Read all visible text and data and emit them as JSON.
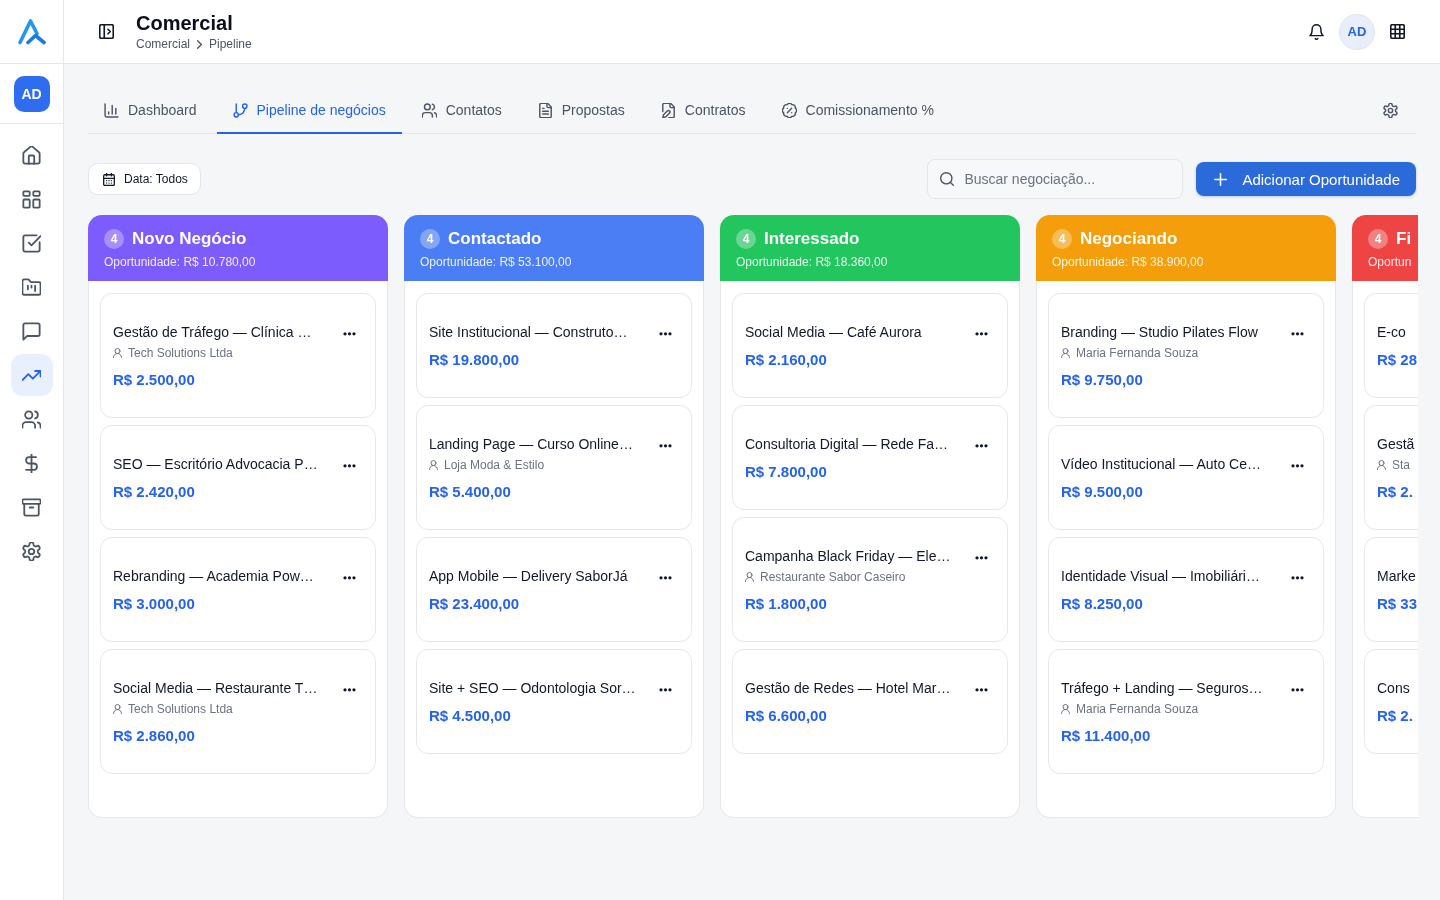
{
  "sidebar": {
    "avatar": "AD",
    "items": [
      {
        "selected": false
      },
      {
        "selected": false
      },
      {
        "selected": false
      },
      {
        "selected": false
      },
      {
        "selected": false
      },
      {
        "selected": true
      },
      {
        "selected": false
      },
      {
        "selected": false
      },
      {
        "selected": false
      },
      {
        "selected": false
      }
    ]
  },
  "header": {
    "title": "Comercial",
    "breadcrumb": [
      "Comercial",
      "Pipeline"
    ],
    "avatar": "AD"
  },
  "tabs": [
    {
      "label": "Dashboard",
      "selected": false
    },
    {
      "label": "Pipeline de negócios",
      "selected": true
    },
    {
      "label": "Contatos",
      "selected": false
    },
    {
      "label": "Propostas",
      "selected": false
    },
    {
      "label": "Contratos",
      "selected": false
    },
    {
      "label": "Comissionamento %",
      "selected": false
    }
  ],
  "toolbar": {
    "date_filter": "Data: Todos",
    "search": {
      "placeholder": "Buscar negociação..."
    },
    "add_button": "Adicionar Oportunidade"
  },
  "columns": [
    {
      "title": "Novo Negócio",
      "count": "4",
      "total": "Oportunidade: R$ 10.780,00",
      "color": "#7c5cfc",
      "cards": [
        {
          "title": "Gestão de Tráfego — Clínica …",
          "client": "Tech Solutions Ltda",
          "value": "R$ 2.500,00",
          "menu": true
        },
        {
          "title": "SEO — Escritório Advocacia P…",
          "value": "R$ 2.420,00",
          "menu": true
        },
        {
          "title": "Rebranding — Academia Pow…",
          "value": "R$ 3.000,00",
          "menu": true
        },
        {
          "title": "Social Media — Restaurante T…",
          "client": "Tech Solutions Ltda",
          "value": "R$ 2.860,00",
          "menu": true
        }
      ]
    },
    {
      "title": "Contactado",
      "count": "4",
      "total": "Oportunidade: R$ 53.100,00",
      "color": "#4b7df4",
      "cards": [
        {
          "title": "Site Institucional — Construto…",
          "value": "R$ 19.800,00",
          "menu": true
        },
        {
          "title": "Landing Page — Curso Online…",
          "client": "Loja Moda & Estilo",
          "value": "R$ 5.400,00",
          "menu": true
        },
        {
          "title": "App Mobile — Delivery SaborJá",
          "value": "R$ 23.400,00",
          "menu": true
        },
        {
          "title": "Site + SEO — Odontologia Sor…",
          "value": "R$ 4.500,00",
          "menu": true
        }
      ]
    },
    {
      "title": "Interessado",
      "count": "4",
      "total": "Oportunidade: R$ 18.360,00",
      "color": "#22c55e",
      "cards": [
        {
          "title": "Social Media — Café Aurora",
          "value": "R$ 2.160,00",
          "menu": true
        },
        {
          "title": "Consultoria Digital — Rede Fa…",
          "value": "R$ 7.800,00",
          "menu": true
        },
        {
          "title": "Campanha Black Friday — Ele…",
          "client": "Restaurante Sabor Caseiro",
          "value": "R$ 1.800,00",
          "menu": true
        },
        {
          "title": "Gestão de Redes — Hotel Mar…",
          "value": "R$ 6.600,00",
          "menu": true
        }
      ]
    },
    {
      "title": "Negociando",
      "count": "4",
      "total": "Oportunidade: R$ 38.900,00",
      "color": "#f59e0b",
      "cards": [
        {
          "title": "Branding — Studio Pilates Flow",
          "client": "Maria Fernanda Souza",
          "value": "R$ 9.750,00",
          "menu": true
        },
        {
          "title": "Vídeo Institucional — Auto Ce…",
          "value": "R$ 9.500,00",
          "menu": true
        },
        {
          "title": "Identidade Visual — Imobiliári…",
          "value": "R$ 8.250,00",
          "menu": true
        },
        {
          "title": "Tráfego + Landing — Seguros…",
          "client": "Maria Fernanda Souza",
          "value": "R$ 11.400,00",
          "menu": true
        }
      ]
    },
    {
      "title": "Fi",
      "count": "4",
      "total": "Oportun",
      "color": "#ef4444",
      "cards": [
        {
          "title": "E-co",
          "value": "R$ 28"
        },
        {
          "title": "Gestã",
          "client": "Sta",
          "value": "R$ 2."
        },
        {
          "title": "Marke",
          "value": "R$ 33"
        },
        {
          "title": "Cons",
          "value": "R$ 2."
        }
      ]
    }
  ]
}
